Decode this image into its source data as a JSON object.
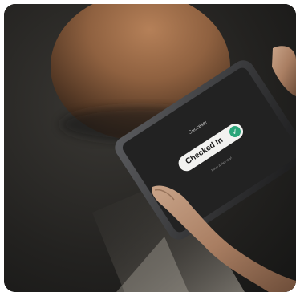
{
  "photo": {
    "description_alt": "Hands holding a tablet showing a check-in confirmation screen"
  },
  "tablet_screen": {
    "heading": "Success!",
    "toggle_label": "Checked In",
    "footnote": "Have a nice day!",
    "accent_color": "#2aa67a",
    "screen_color": "#222222",
    "pill_color": "#f2f2f0"
  },
  "icons": {
    "toggle_knob": "check-icon"
  }
}
